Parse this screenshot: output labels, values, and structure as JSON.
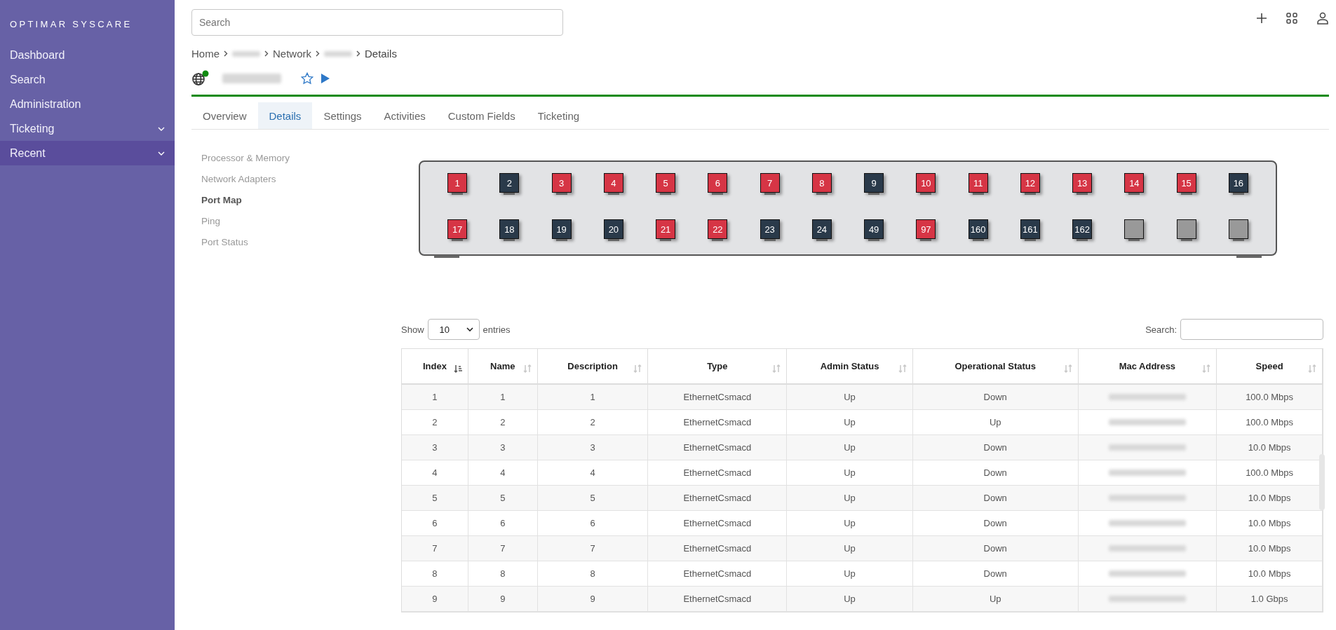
{
  "sidebar": {
    "logo": "OPTIMAR SYSCARE",
    "items": [
      {
        "label": "Dashboard",
        "selected": false,
        "has_submenu": false
      },
      {
        "label": "Search",
        "selected": false,
        "has_submenu": false
      },
      {
        "label": "Administration",
        "selected": false,
        "has_submenu": false
      },
      {
        "label": "Ticketing",
        "selected": false,
        "has_submenu": true
      },
      {
        "label": "Recent",
        "selected": true,
        "has_submenu": true
      }
    ]
  },
  "search": {
    "placeholder": "Search"
  },
  "breadcrumb": [
    {
      "label": "Home",
      "kind": "text"
    },
    {
      "kind": "redacted"
    },
    {
      "label": "Network",
      "kind": "text"
    },
    {
      "kind": "redacted"
    },
    {
      "label": "Details",
      "kind": "text"
    }
  ],
  "device": {
    "online": true
  },
  "tabs": [
    {
      "label": "Overview",
      "selected": false
    },
    {
      "label": "Details",
      "selected": true
    },
    {
      "label": "Settings",
      "selected": false
    },
    {
      "label": "Activities",
      "selected": false
    },
    {
      "label": "Custom Fields",
      "selected": false
    },
    {
      "label": "Ticketing",
      "selected": false
    }
  ],
  "sections": [
    {
      "label": "Processor & Memory",
      "selected": false
    },
    {
      "label": "Network Adapters",
      "selected": false
    },
    {
      "label": "Port Map",
      "selected": true
    },
    {
      "label": "Ping",
      "selected": false
    },
    {
      "label": "Port Status",
      "selected": false
    }
  ],
  "port_map": [
    {
      "label": "1",
      "kind": "down"
    },
    {
      "label": "2",
      "kind": "up"
    },
    {
      "label": "3",
      "kind": "down"
    },
    {
      "label": "4",
      "kind": "down"
    },
    {
      "label": "5",
      "kind": "down"
    },
    {
      "label": "6",
      "kind": "down"
    },
    {
      "label": "7",
      "kind": "down"
    },
    {
      "label": "8",
      "kind": "down"
    },
    {
      "label": "9",
      "kind": "up"
    },
    {
      "label": "10",
      "kind": "down"
    },
    {
      "label": "11",
      "kind": "down"
    },
    {
      "label": "12",
      "kind": "down"
    },
    {
      "label": "13",
      "kind": "down"
    },
    {
      "label": "14",
      "kind": "down"
    },
    {
      "label": "15",
      "kind": "down"
    },
    {
      "label": "16",
      "kind": "up"
    },
    {
      "label": "17",
      "kind": "down"
    },
    {
      "label": "18",
      "kind": "up"
    },
    {
      "label": "19",
      "kind": "up"
    },
    {
      "label": "20",
      "kind": "up"
    },
    {
      "label": "21",
      "kind": "down"
    },
    {
      "label": "22",
      "kind": "down"
    },
    {
      "label": "23",
      "kind": "up"
    },
    {
      "label": "24",
      "kind": "up"
    },
    {
      "label": "49",
      "kind": "up"
    },
    {
      "label": "97",
      "kind": "down"
    },
    {
      "label": "160",
      "kind": "up"
    },
    {
      "label": "161",
      "kind": "up"
    },
    {
      "label": "162",
      "kind": "up"
    },
    {
      "kind": "unused"
    },
    {
      "kind": "unused"
    },
    {
      "kind": "unused"
    }
  ],
  "table": {
    "show_label": "Show",
    "page_size": "10",
    "entries_label": "entries",
    "search_label": "Search:",
    "columns": [
      {
        "label": "Index",
        "sorted": true
      },
      {
        "label": "Name",
        "sorted": false
      },
      {
        "label": "Description",
        "sorted": false
      },
      {
        "label": "Type",
        "sorted": false
      },
      {
        "label": "Admin Status",
        "sorted": false
      },
      {
        "label": "Operational Status",
        "sorted": false
      },
      {
        "label": "Mac Address",
        "sorted": false
      },
      {
        "label": "Speed",
        "sorted": false
      }
    ],
    "rows": [
      {
        "index": "1",
        "name": "1",
        "description": "1",
        "type": "EthernetCsmacd",
        "admin_status": "Up",
        "operational_status": "Down",
        "speed": "100.0 Mbps"
      },
      {
        "index": "2",
        "name": "2",
        "description": "2",
        "type": "EthernetCsmacd",
        "admin_status": "Up",
        "operational_status": "Up",
        "speed": "100.0 Mbps"
      },
      {
        "index": "3",
        "name": "3",
        "description": "3",
        "type": "EthernetCsmacd",
        "admin_status": "Up",
        "operational_status": "Down",
        "speed": "10.0 Mbps"
      },
      {
        "index": "4",
        "name": "4",
        "description": "4",
        "type": "EthernetCsmacd",
        "admin_status": "Up",
        "operational_status": "Down",
        "speed": "100.0 Mbps"
      },
      {
        "index": "5",
        "name": "5",
        "description": "5",
        "type": "EthernetCsmacd",
        "admin_status": "Up",
        "operational_status": "Down",
        "speed": "10.0 Mbps"
      },
      {
        "index": "6",
        "name": "6",
        "description": "6",
        "type": "EthernetCsmacd",
        "admin_status": "Up",
        "operational_status": "Down",
        "speed": "10.0 Mbps"
      },
      {
        "index": "7",
        "name": "7",
        "description": "7",
        "type": "EthernetCsmacd",
        "admin_status": "Up",
        "operational_status": "Down",
        "speed": "10.0 Mbps"
      },
      {
        "index": "8",
        "name": "8",
        "description": "8",
        "type": "EthernetCsmacd",
        "admin_status": "Up",
        "operational_status": "Down",
        "speed": "10.0 Mbps"
      },
      {
        "index": "9",
        "name": "9",
        "description": "9",
        "type": "EthernetCsmacd",
        "admin_status": "Up",
        "operational_status": "Up",
        "speed": "1.0 Gbps"
      }
    ]
  }
}
